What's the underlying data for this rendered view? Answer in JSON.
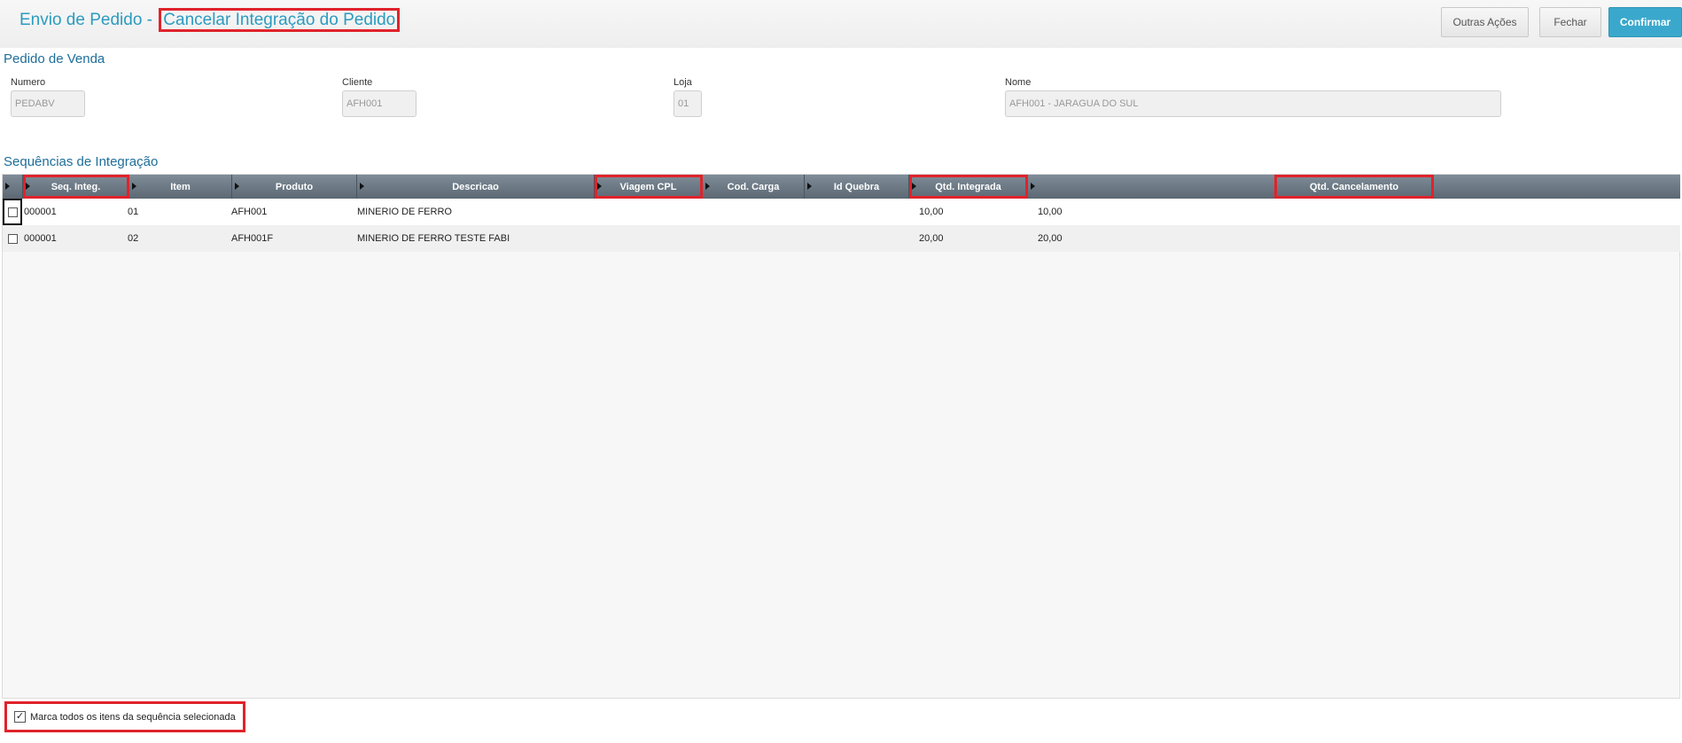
{
  "header": {
    "title_main": "Envio de Pedido -",
    "title_sub": "Cancelar Integração do Pedido",
    "buttons": {
      "outras": "Outras Ações",
      "fechar": "Fechar",
      "confirmar": "Confirmar"
    }
  },
  "pedido": {
    "section_title": "Pedido de Venda",
    "numero": {
      "label": "Numero",
      "value": "PEDABV"
    },
    "cliente": {
      "label": "Cliente",
      "value": "AFH001"
    },
    "loja": {
      "label": "Loja",
      "value": "01"
    },
    "nome": {
      "label": "Nome",
      "value": "AFH001 - JARAGUA DO SUL"
    }
  },
  "sequencias": {
    "section_title": "Sequências de Integração",
    "columns": [
      "Seq. Integ.",
      "Item",
      "Produto",
      "Descricao",
      "Viagem CPL",
      "Cod. Carga",
      "Id Quebra",
      "Qtd. Integrada",
      "Qtd. Cancelamento"
    ],
    "rows": [
      {
        "seq": "000001",
        "item": "01",
        "produto": "AFH001",
        "descricao": "MINERIO DE FERRO",
        "viagem": "",
        "carga": "",
        "quebra": "",
        "qtd_integrada": "10,00",
        "qtd_cancelamento": "10,00"
      },
      {
        "seq": "000001",
        "item": "02",
        "produto": "AFH001F",
        "descricao": "MINERIO DE FERRO  TESTE FABI",
        "viagem": "",
        "carga": "",
        "quebra": "",
        "qtd_integrada": "20,00",
        "qtd_cancelamento": "20,00"
      }
    ]
  },
  "footer": {
    "check_label": "Marca todos os itens da sequência selecionada",
    "checked": true
  },
  "colors": {
    "accent": "#3aa8cc",
    "title": "#2b9bbf",
    "highlight": "#e0232b",
    "header_grid": "#6a7782"
  }
}
